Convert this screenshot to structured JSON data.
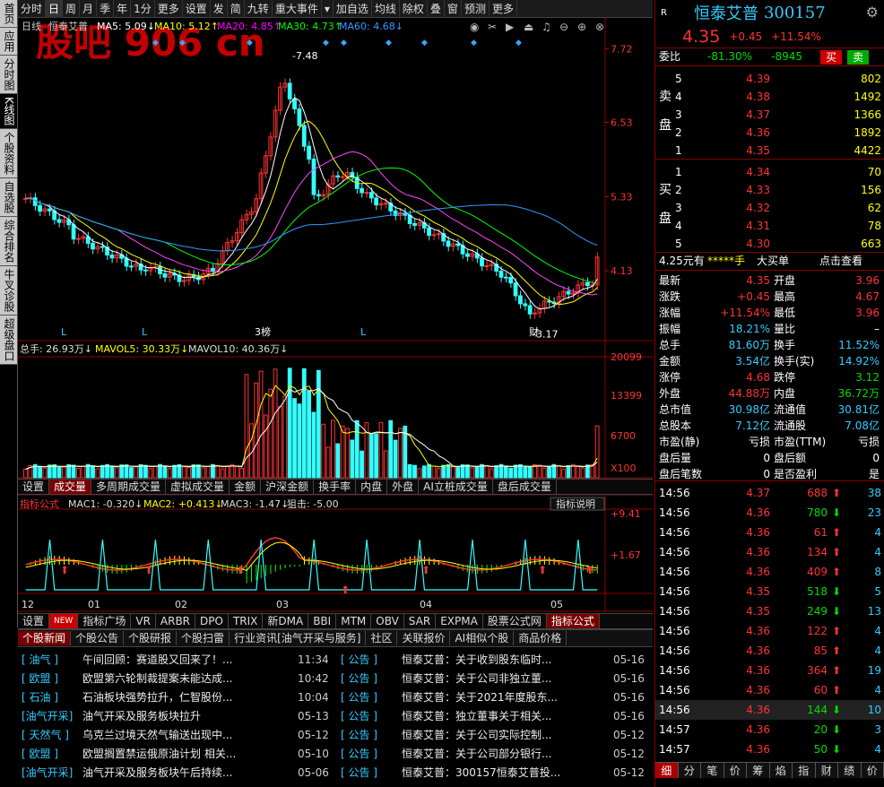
{
  "left_tabs": [
    "首页",
    "应用",
    "分时图",
    "K线图",
    "个股资料",
    "自选股",
    "综合排名",
    "牛叉诊股",
    "超级盘口"
  ],
  "toolbar": [
    "分时",
    "日",
    "周",
    "月",
    "季",
    "年",
    "1分",
    "更多",
    "设置",
    "发",
    "简",
    "九转",
    "重大事件",
    "▾",
    "加自选",
    "均线",
    "除权",
    "叠",
    "窗",
    "预测",
    "更多"
  ],
  "chart_header": {
    "period": "日线",
    "name": "恒泰艾普",
    "ma5": "MA5: 5.09↓",
    "ma10": "MA10: 5.12↑",
    "ma20": "MA20: 4.85↑",
    "ma30": "MA30: 4.73↑",
    "ma60": "MA60: 4.68↓"
  },
  "watermark": "股吧 906 cn",
  "price_axis": [
    "7.72",
    "6.53",
    "5.33",
    "4.13"
  ],
  "high_label": "7.48",
  "low_label": "3.17",
  "kline_marks": [
    "L",
    "L",
    "3榜",
    "L",
    "财"
  ],
  "vol_header": {
    "total": "总手: 26.93万↓",
    "v5": "MAVOL5: 30.33万↓",
    "v10": "MAVOL10: 40.36万↓"
  },
  "vol_axis": [
    "20099",
    "13399",
    "6700",
    "X100"
  ],
  "vol_tabs": [
    "设置",
    "成交量",
    "多周期成交量",
    "虚拟成交量",
    "金额",
    "沪深金额",
    "换手率",
    "内盘",
    "外盘",
    "AI立桩成交量",
    "盘后成交量"
  ],
  "macd_header": {
    "name": "指标公式",
    "m1": "MAC1: -0.320↓",
    "m2": "MAC2: +0.413↓",
    "m3": "MAC3: -1.47↓",
    "m4": "狙击: -5.00"
  },
  "macd_btn": "指标说明",
  "macd_axis": [
    "+9.41",
    "+1.67"
  ],
  "date_axis": [
    "12",
    "01",
    "02",
    "03",
    "04",
    "05"
  ],
  "ind_tabs": [
    "设置",
    "NEW",
    "指标广场",
    "VR",
    "ARBR",
    "DPO",
    "TRIX",
    "新DMA",
    "BBI",
    "MTM",
    "OBV",
    "SAR",
    "EXPMA",
    "股票公式网",
    "指标公式"
  ],
  "news_tabs": [
    "个股新闻",
    "个股公告",
    "个股研报",
    "个股扫雷",
    "行业资讯[油气开采与服务]",
    "社区",
    "关联报价",
    "AI相似个股",
    "商品价格"
  ],
  "news_left": [
    {
      "tag": "[ 油气 ]",
      "title": "午间回顾：赛道股又回来了！...",
      "time": "11:34"
    },
    {
      "tag": "[ 欧盟 ]",
      "title": "欧盟第六轮制裁提案未能达成...",
      "time": "10:42"
    },
    {
      "tag": "[ 石油 ]",
      "title": "石油板块强势拉升，仁智股份...",
      "time": "10:04"
    },
    {
      "tag": "[油气开采]",
      "title": "油气开采及服务板块拉升",
      "time": "05-13"
    },
    {
      "tag": "[ 天然气 ]",
      "title": "乌克兰过境天然气输送出现中...",
      "time": "05-12"
    },
    {
      "tag": "[ 欧盟 ]",
      "title": "欧盟搁置禁运俄原油计划 相关...",
      "time": "05-10"
    },
    {
      "tag": "[油气开采]",
      "title": "油气开采及服务板块午后持续...",
      "time": "05-06"
    }
  ],
  "news_right": [
    {
      "tag": "[ 公告 ]",
      "title": "恒泰艾普：关于收到股东临时...",
      "time": "05-16"
    },
    {
      "tag": "[ 公告 ]",
      "title": "恒泰艾普：关于公司非独立董...",
      "time": "05-16"
    },
    {
      "tag": "[ 公告 ]",
      "title": "恒泰艾普：关于2021年度股东...",
      "time": "05-16"
    },
    {
      "tag": "[ 公告 ]",
      "title": "恒泰艾普：独立董事关于相关...",
      "time": "05-16"
    },
    {
      "tag": "[ 公告 ]",
      "title": "恒泰艾普：关于公司实际控制...",
      "time": "05-12"
    },
    {
      "tag": "[ 公告 ]",
      "title": "恒泰艾普：关于公司部分银行...",
      "time": "05-12"
    },
    {
      "tag": "[ 公告 ]",
      "title": "恒泰艾普：300157恒泰艾普投...",
      "time": "05-12"
    }
  ],
  "quote": {
    "r": "R",
    "name": "恒泰艾普",
    "code": "300157",
    "price": "4.35",
    "chg": "+0.45",
    "pct": "+11.54%",
    "weibi_label": "委比",
    "weibi": "-81.30%",
    "weicha": "-8945",
    "buy": "买",
    "sell": "卖"
  },
  "asks": [
    [
      "5",
      "4.39",
      "802"
    ],
    [
      "4",
      "4.38",
      "1492"
    ],
    [
      "3",
      "4.37",
      "1366"
    ],
    [
      "2",
      "4.36",
      "1892"
    ],
    [
      "1",
      "4.35",
      "4422"
    ]
  ],
  "ask_label": [
    "卖",
    "盘"
  ],
  "bids": [
    [
      "1",
      "4.34",
      "70"
    ],
    [
      "2",
      "4.33",
      "156"
    ],
    [
      "3",
      "4.32",
      "62"
    ],
    [
      "4",
      "4.31",
      "78"
    ],
    [
      "5",
      "4.30",
      "663"
    ]
  ],
  "bid_label": [
    "买",
    "盘"
  ],
  "bigorder": {
    "price": "4.25元有",
    "hand": "*****手",
    "label": "大买单",
    "link": "点击查看"
  },
  "stats": [
    [
      "最新",
      "4.35",
      "开盘",
      "3.96"
    ],
    [
      "涨跌",
      "+0.45",
      "最高",
      "4.67"
    ],
    [
      "涨幅",
      "+11.54%",
      "最低",
      "3.96"
    ],
    [
      "振幅",
      "18.21%",
      "量比",
      "–"
    ],
    [
      "总手",
      "81.60万",
      "换手",
      "11.52%"
    ],
    [
      "金额",
      "3.54亿",
      "换手(实)",
      "14.92%"
    ],
    [
      "涨停",
      "4.68",
      "跌停",
      "3.12"
    ],
    [
      "外盘",
      "44.88万",
      "内盘",
      "36.72万"
    ],
    [
      "总市值",
      "30.98亿",
      "流通值",
      "30.81亿"
    ],
    [
      "总股本",
      "7.12亿",
      "流通股",
      "7.08亿"
    ],
    [
      "市盈(静)",
      "亏损",
      "市盈(TTM)",
      "亏损"
    ],
    [
      "盘后量",
      "0",
      "盘后额",
      "0"
    ],
    [
      "盘后笔数",
      "0",
      "是否盈利",
      "是"
    ]
  ],
  "ticks": [
    [
      "14:56",
      "4.37",
      "688",
      "up",
      "38"
    ],
    [
      "14:56",
      "4.36",
      "780",
      "down",
      "23"
    ],
    [
      "14:56",
      "4.36",
      "61",
      "up",
      "4"
    ],
    [
      "14:56",
      "4.36",
      "134",
      "up",
      "4"
    ],
    [
      "14:56",
      "4.36",
      "409",
      "up",
      "8"
    ],
    [
      "14:56",
      "4.35",
      "518",
      "down",
      "5"
    ],
    [
      "14:56",
      "4.35",
      "249",
      "down",
      "13"
    ],
    [
      "14:56",
      "4.36",
      "122",
      "up",
      "4"
    ],
    [
      "14:56",
      "4.36",
      "85",
      "up",
      "4"
    ],
    [
      "14:56",
      "4.36",
      "364",
      "up",
      "19"
    ],
    [
      "14:56",
      "4.36",
      "60",
      "up",
      "4"
    ],
    [
      "14:56",
      "4.36",
      "144",
      "down",
      "10"
    ],
    [
      "14:57",
      "4.36",
      "20",
      "down",
      "3"
    ],
    [
      "14:57",
      "4.36",
      "50",
      "down",
      "4"
    ]
  ],
  "bottom_tabs": [
    "细",
    "分",
    "笔",
    "价",
    "筹",
    "焰",
    "指",
    "财",
    "绩",
    "价"
  ]
}
